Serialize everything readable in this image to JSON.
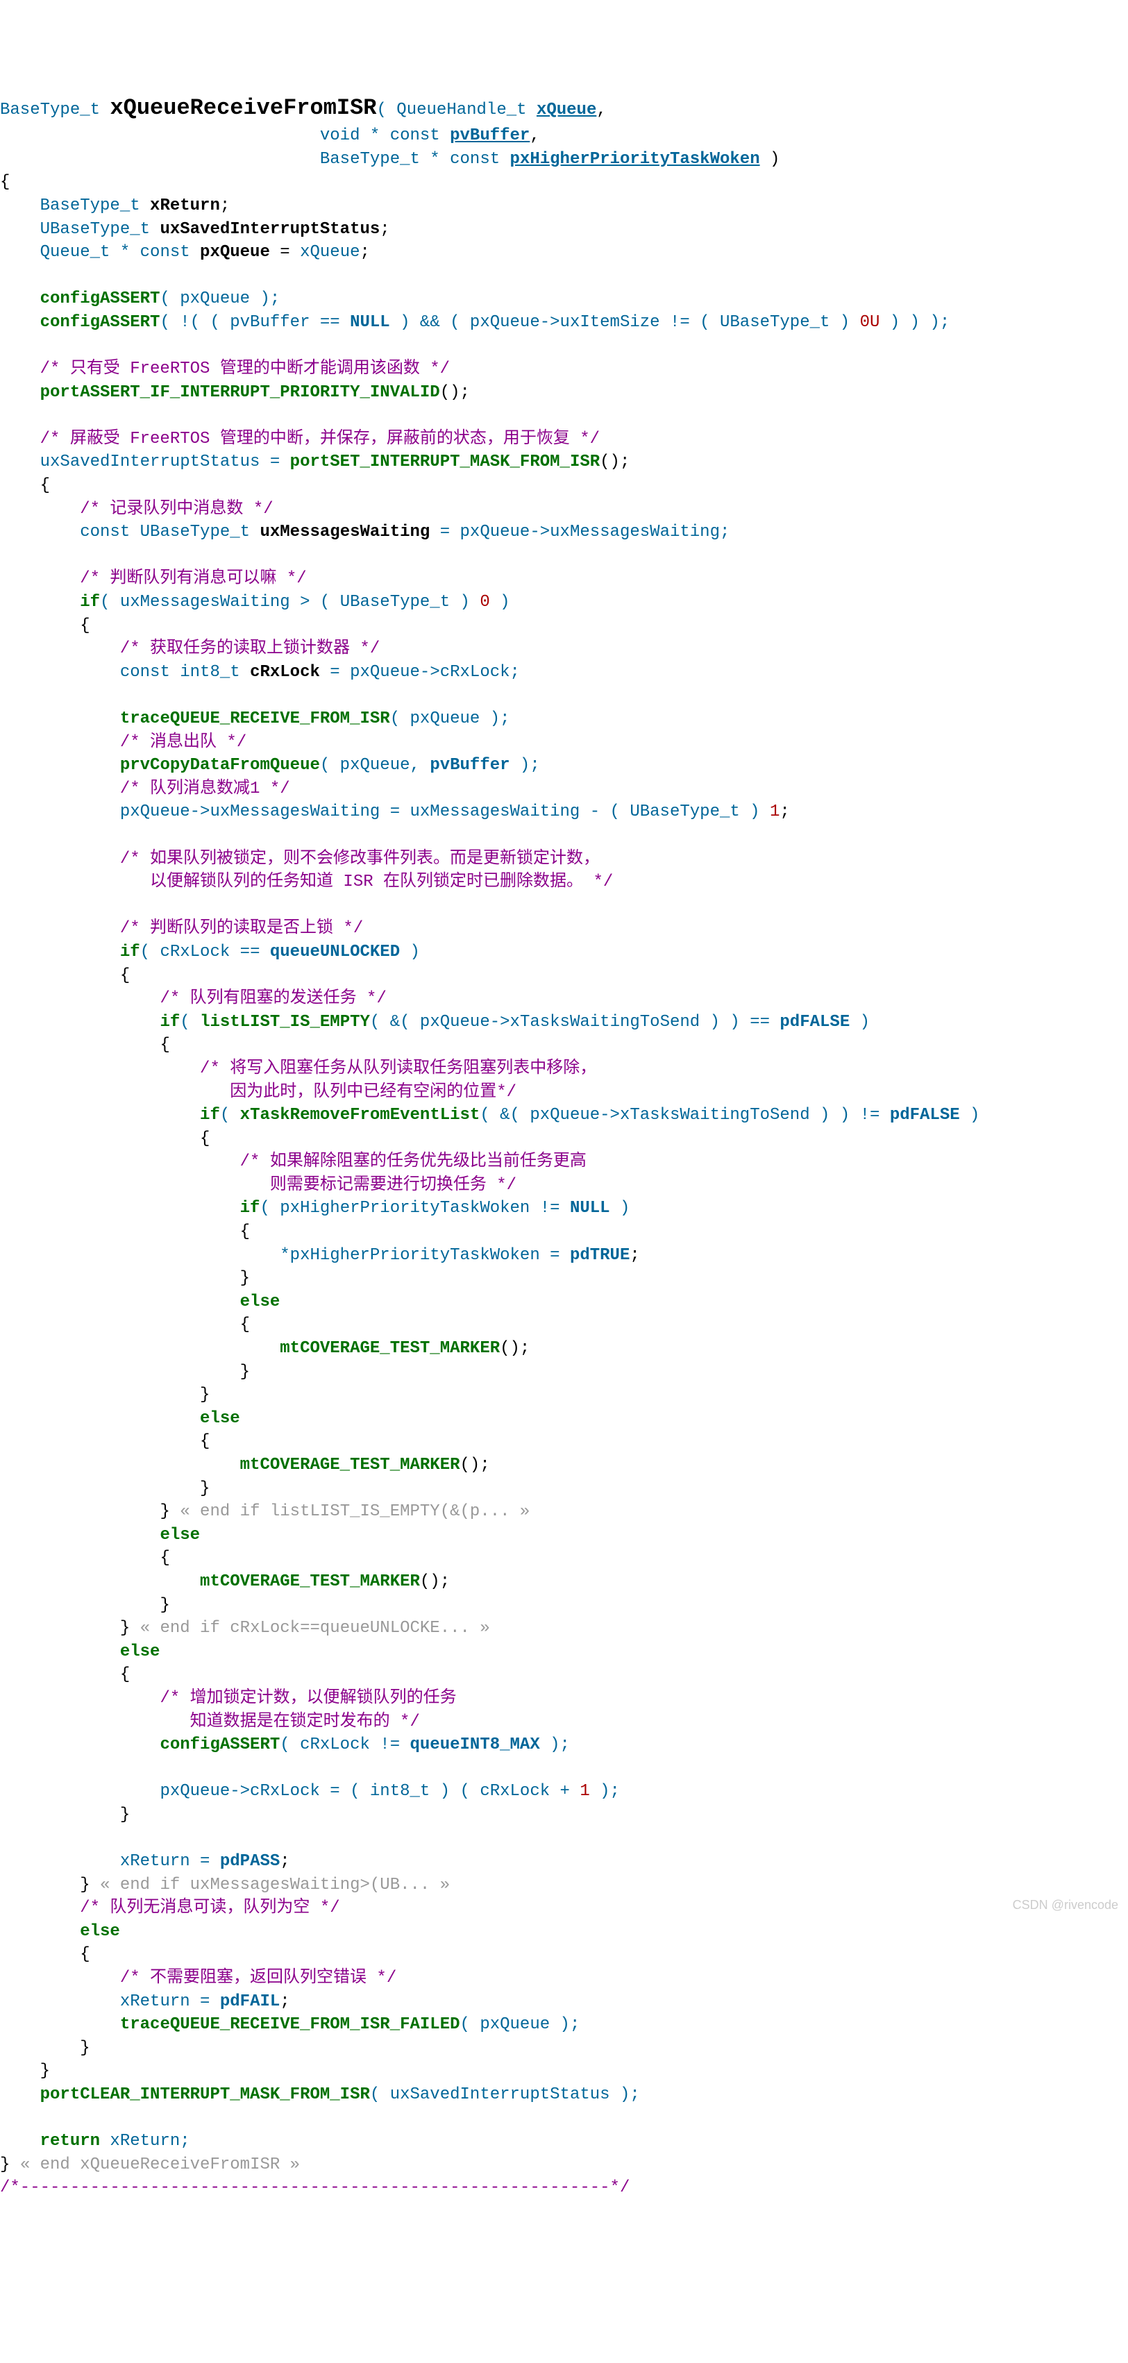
{
  "watermark": "CSDN @rivencode",
  "code": {
    "l01": "BaseType_t ",
    "l01b": "xQueueReceiveFromISR",
    "l01c": "( QueueHandle_t ",
    "l01d": "xQueue",
    "l01e": ",",
    "l02a": "                                void * const ",
    "l02b": "pvBuffer",
    "l02c": ",",
    "l03a": "                                BaseType_t * const ",
    "l03b": "pxHigherPriorityTaskWoken",
    "l03c": " )",
    "l04": "{",
    "l05a": "    BaseType_t ",
    "l05b": "xReturn",
    "l05c": ";",
    "l06a": "    UBaseType_t ",
    "l06b": "uxSavedInterruptStatus",
    "l06c": ";",
    "l07a": "    Queue_t * const ",
    "l07b": "pxQueue",
    "l07c": " = ",
    "l07d": "xQueue",
    "l07e": ";",
    "l08": "",
    "l09a": "    configASSERT",
    "l09b": "( pxQueue );",
    "l10a": "    configASSERT",
    "l10b": "( !( ( pvBuffer == ",
    "l10c": "NULL",
    "l10d": " ) && ( pxQueue->uxItemSize != ( UBaseType_t ) ",
    "l10e": "0U",
    "l10f": " ) ) );",
    "l11": "",
    "l12": "    /* 只有受 FreeRTOS 管理的中断才能调用该函数 */",
    "l13a": "    portASSERT_IF_INTERRUPT_PRIORITY_INVALID",
    "l13b": "();",
    "l14": "",
    "l15": "    /* 屏蔽受 FreeRTOS 管理的中断，并保存，屏蔽前的状态，用于恢复 */",
    "l16a": "    uxSavedInterruptStatus = ",
    "l16b": "portSET_INTERRUPT_MASK_FROM_ISR",
    "l16c": "();",
    "l17": "    {",
    "l18": "        /* 记录队列中消息数 */",
    "l19a": "        const UBaseType_t ",
    "l19b": "uxMessagesWaiting",
    "l19c": " = pxQueue->uxMessagesWaiting;",
    "l20": "",
    "l21": "        /* 判断队列有消息可以嘛 */",
    "l22a": "        if",
    "l22b": "( uxMessagesWaiting > ( UBaseType_t ) ",
    "l22c": "0",
    "l22d": " )",
    "l23": "        {",
    "l24": "            /* 获取任务的读取上锁计数器 */",
    "l25a": "            const int8_t ",
    "l25b": "cRxLock",
    "l25c": " = pxQueue->cRxLock;",
    "l26": "",
    "l27a": "            traceQUEUE_RECEIVE_FROM_ISR",
    "l27b": "( pxQueue );",
    "l28": "            /* 消息出队 */",
    "l29a": "            prvCopyDataFromQueue",
    "l29b": "( pxQueue, ",
    "l29c": "pvBuffer",
    "l29d": " );",
    "l30": "            /* 队列消息数减1 */",
    "l31a": "            pxQueue->uxMessagesWaiting = uxMessagesWaiting - ( UBaseType_t ) ",
    "l31b": "1",
    "l31c": ";",
    "l32": "",
    "l33": "            /* 如果队列被锁定，则不会修改事件列表。而是更新锁定计数，",
    "l34": "               以便解锁队列的任务知道 ISR 在队列锁定时已删除数据。 */",
    "l35": "",
    "l36": "            /* 判断队列的读取是否上锁 */",
    "l37a": "            if",
    "l37b": "( cRxLock == ",
    "l37c": "queueUNLOCKED",
    "l37d": " )",
    "l38": "            {",
    "l39": "                /* 队列有阻塞的发送任务 */",
    "l40a": "                if",
    "l40b": "( ",
    "l40c": "listLIST_IS_EMPTY",
    "l40d": "( &( pxQueue->xTasksWaitingToSend ) ) == ",
    "l40e": "pdFALSE",
    "l40f": " )",
    "l41": "                {",
    "l42": "                    /* 将写入阻塞任务从队列读取任务阻塞列表中移除，",
    "l43": "                       因为此时，队列中已经有空闲的位置*/",
    "l44a": "                    if",
    "l44b": "( ",
    "l44c": "xTaskRemoveFromEventList",
    "l44d": "( &( pxQueue->xTasksWaitingToSend ) ) != ",
    "l44e": "pdFALSE",
    "l44f": " )",
    "l45": "                    {",
    "l46": "                        /* 如果解除阻塞的任务优先级比当前任务更高",
    "l47": "                           则需要标记需要进行切换任务 */",
    "l48a": "                        if",
    "l48b": "( pxHigherPriorityTaskWoken != ",
    "l48c": "NULL",
    "l48d": " )",
    "l49": "                        {",
    "l50a": "                            *pxHigherPriorityTaskWoken = ",
    "l50b": "pdTRUE",
    "l50c": ";",
    "l51": "                        }",
    "l52a": "                        else",
    "l53": "                        {",
    "l54a": "                            mtCOVERAGE_TEST_MARKER",
    "l54b": "();",
    "l55": "                        }",
    "l56": "                    }",
    "l57a": "                    else",
    "l58": "                    {",
    "l59a": "                        mtCOVERAGE_TEST_MARKER",
    "l59b": "();",
    "l60": "                    }",
    "l61a": "                } ",
    "l61b": "« end if listLIST_IS_EMPTY(&(p... »",
    "l62a": "                else",
    "l63": "                {",
    "l64a": "                    mtCOVERAGE_TEST_MARKER",
    "l64b": "();",
    "l65": "                }",
    "l66a": "            } ",
    "l66b": "« end if cRxLock==queueUNLOCKE... »",
    "l67a": "            else",
    "l68": "            {",
    "l69": "                /* 增加锁定计数，以便解锁队列的任务",
    "l70": "                   知道数据是在锁定时发布的 */",
    "l71a": "                configASSERT",
    "l71b": "( cRxLock != ",
    "l71c": "queueINT8_MAX",
    "l71d": " );",
    "l72": "",
    "l73a": "                pxQueue->cRxLock = ( int8_t ) ( cRxLock + ",
    "l73b": "1",
    "l73c": " );",
    "l74": "            }",
    "l75": "",
    "l76a": "            xReturn = ",
    "l76b": "pdPASS",
    "l76c": ";",
    "l77a": "        } ",
    "l77b": "« end if uxMessagesWaiting>(UB... »",
    "l78": "        /* 队列无消息可读，队列为空 */",
    "l79a": "        else",
    "l80": "        {",
    "l81": "            /* 不需要阻塞，返回队列空错误 */",
    "l82a": "            xReturn = ",
    "l82b": "pdFAIL",
    "l82c": ";",
    "l83a": "            traceQUEUE_RECEIVE_FROM_ISR_FAILED",
    "l83b": "( pxQueue );",
    "l84": "        }",
    "l85": "    }",
    "l86a": "    portCLEAR_INTERRUPT_MASK_FROM_ISR",
    "l86b": "( uxSavedInterruptStatus );",
    "l87": "",
    "l88a": "    return",
    "l88b": " xReturn;",
    "l89a": "} ",
    "l89b": "« end xQueueReceiveFromISR »",
    "l90": "/*-----------------------------------------------------------*/"
  }
}
